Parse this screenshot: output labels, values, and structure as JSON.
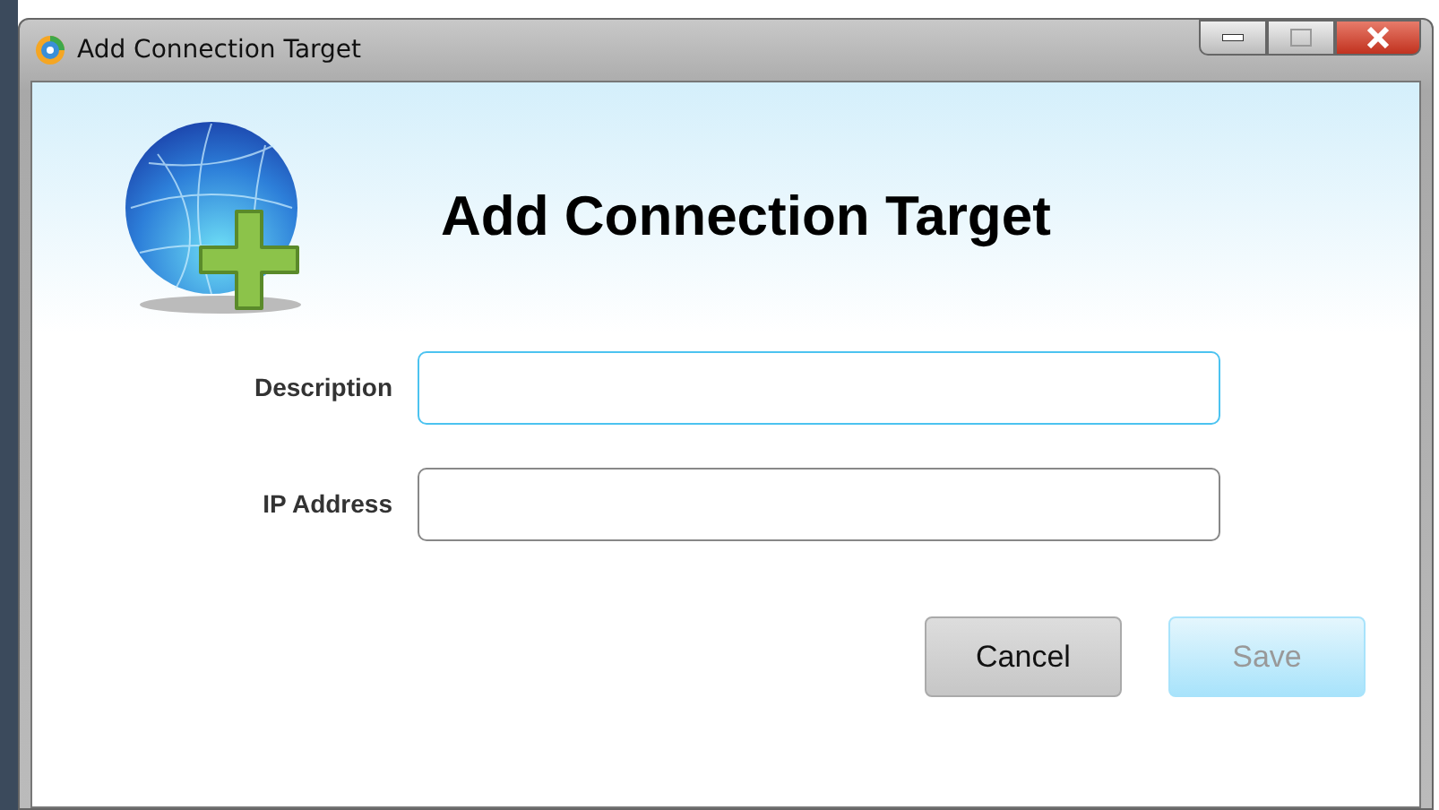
{
  "window": {
    "title": "Add Connection Target"
  },
  "heading": "Add Connection Target",
  "fields": [
    {
      "label": "Description",
      "focused": true
    },
    {
      "label": "IP Address",
      "focused": false
    }
  ],
  "buttons": [
    {
      "label": "Cancel",
      "disabled": false
    },
    {
      "label": "Save",
      "disabled": true
    }
  ]
}
